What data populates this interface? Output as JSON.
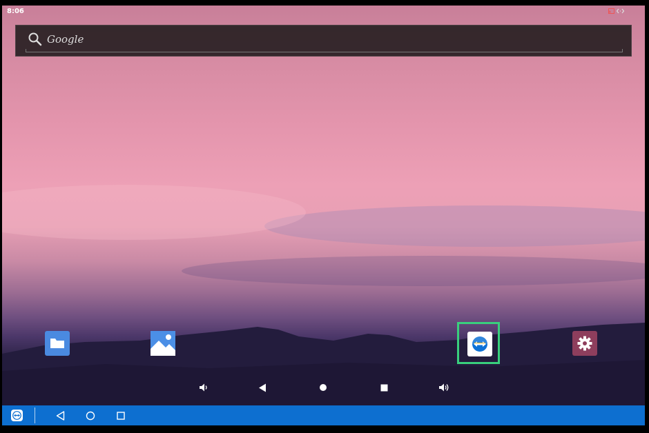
{
  "status_bar": {
    "time": "8:06",
    "icons": [
      "cast-icon",
      "code-icon"
    ]
  },
  "search": {
    "label": "Google",
    "icon": "search-icon"
  },
  "dock": {
    "apps": [
      {
        "name": "files-app",
        "icon": "folder-icon"
      },
      {
        "name": "photos-app",
        "icon": "image-icon"
      },
      {
        "name": "teamviewer-app",
        "icon": "teamviewer-icon",
        "highlighted": true
      },
      {
        "name": "settings-app",
        "icon": "gear-icon"
      }
    ],
    "highlight_color": "#39d07d"
  },
  "android_nav": [
    "volume-down-icon",
    "back-icon",
    "home-icon",
    "recents-icon",
    "volume-up-icon"
  ],
  "taskbar": {
    "color": "#0d6fd0",
    "buttons": [
      "teamviewer-logo-icon",
      "back-icon",
      "home-icon",
      "recents-icon"
    ]
  }
}
